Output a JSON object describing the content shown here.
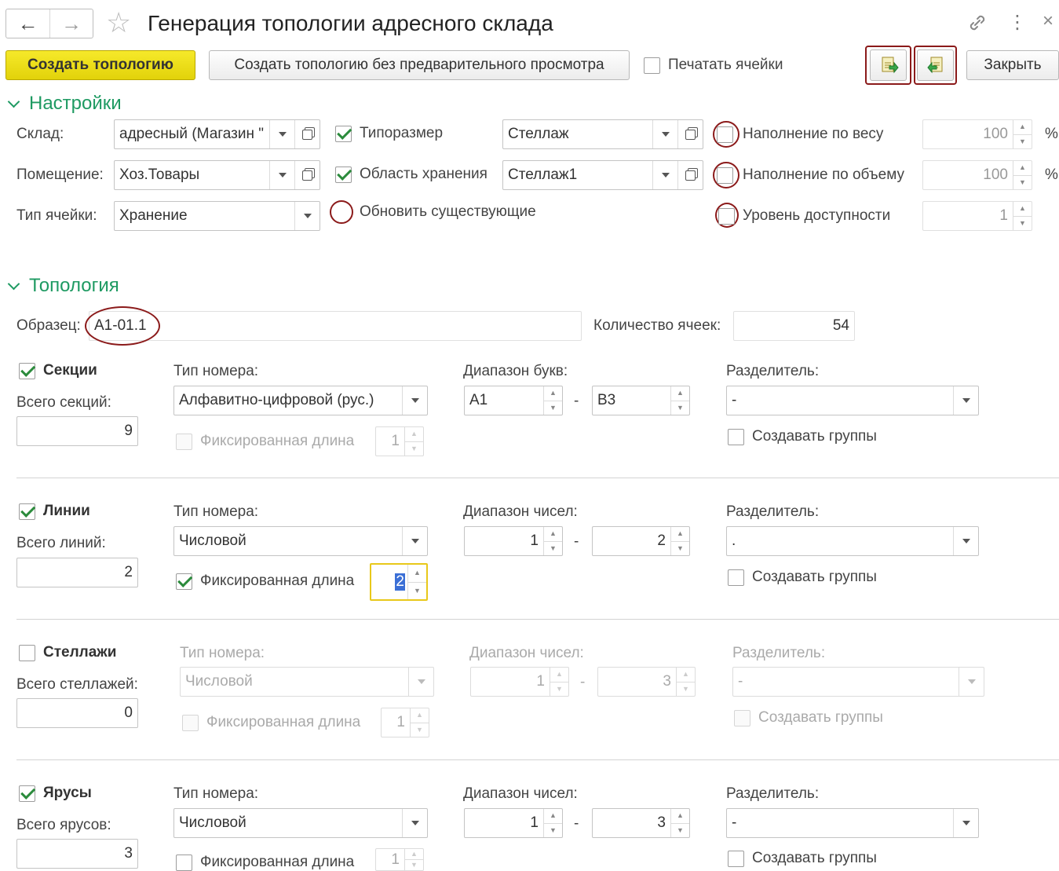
{
  "window": {
    "title": "Генерация топологии адресного склада",
    "back_icon": "←",
    "forward_icon": "→",
    "star_icon": "☆",
    "link_icon": "🔗",
    "more_icon": "⋮",
    "close_icon": "×"
  },
  "toolbar": {
    "create_label": "Создать топологию",
    "create_no_preview_label": "Создать топологию без предварительного просмотра",
    "print_cells_label": "Печатать ячейки",
    "close_label": "Закрыть"
  },
  "settings": {
    "header": "Настройки",
    "warehouse_label": "Склад:",
    "warehouse_value": "адресный (Магазин \"",
    "room_label": "Помещение:",
    "room_value": "Хоз.Товары",
    "cell_type_label": "Тип ячейки:",
    "cell_type_value": "Хранение",
    "size_label": "Типоразмер",
    "size_value": "Стеллаж",
    "storage_area_label": "Область хранения",
    "storage_area_value": "Стеллаж1",
    "update_existing_label": "Обновить существующие",
    "fill_weight_label": "Наполнение по весу",
    "fill_weight_value": "100",
    "fill_volume_label": "Наполнение по объему",
    "fill_volume_value": "100",
    "access_level_label": "Уровень доступности",
    "access_level_value": "1",
    "percent": "%"
  },
  "topology": {
    "header": "Топология",
    "sample_label": "Образец:",
    "sample_value": "А1-01.1",
    "cell_count_label": "Количество ячеек:",
    "cell_count_value": "54",
    "sections": {
      "title": "Секции",
      "total_label": "Всего секций:",
      "total_value": "9",
      "number_type_label": "Тип номера:",
      "number_type_value": "Алфавитно-цифровой (рус.)",
      "range_label": "Диапазон букв:",
      "range_from": "А1",
      "range_to": "В3",
      "separator_label": "Разделитель:",
      "separator_value": "-",
      "fixed_length_label": "Фиксированная длина",
      "fixed_length_value": "1",
      "create_groups_label": "Создавать группы"
    },
    "lines": {
      "title": "Линии",
      "total_label": "Всего линий:",
      "total_value": "2",
      "number_type_label": "Тип номера:",
      "number_type_value": "Числовой",
      "range_label": "Диапазон чисел:",
      "range_from": "1",
      "range_to": "2",
      "separator_label": "Разделитель:",
      "separator_value": ".",
      "fixed_length_label": "Фиксированная длина",
      "fixed_length_value": "2",
      "create_groups_label": "Создавать группы"
    },
    "racks": {
      "title": "Стеллажи",
      "total_label": "Всего стеллажей:",
      "total_value": "0",
      "number_type_label": "Тип номера:",
      "number_type_value": "Числовой",
      "range_label": "Диапазон чисел:",
      "range_from": "1",
      "range_to": "3",
      "separator_label": "Разделитель:",
      "separator_value": "-",
      "fixed_length_label": "Фиксированная длина",
      "fixed_length_value": "1",
      "create_groups_label": "Создавать группы"
    },
    "tiers": {
      "title": "Ярусы",
      "total_label": "Всего ярусов:",
      "total_value": "3",
      "number_type_label": "Тип номера:",
      "number_type_value": "Числовой",
      "range_label": "Диапазон чисел:",
      "range_from": "1",
      "range_to": "3",
      "separator_label": "Разделитель:",
      "separator_value": "-",
      "fixed_length_label": "Фиксированная длина",
      "fixed_length_value": "1",
      "create_groups_label": "Создавать группы"
    }
  },
  "colors": {
    "accent_green": "#1e9a62",
    "primary_button": "#f2e31d",
    "highlight_ring": "#8b1a1a",
    "focus_border": "#e8c81a"
  }
}
